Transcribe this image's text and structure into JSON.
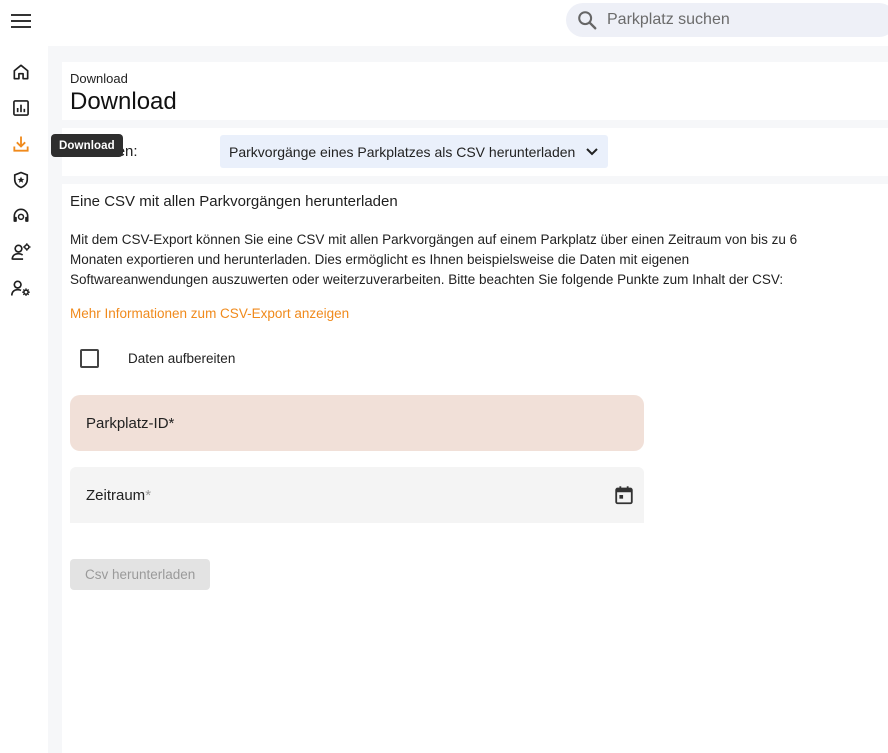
{
  "header": {
    "menu_icon": "hamburger-menu-icon",
    "search": {
      "placeholder": "Parkplatz suchen",
      "value": "",
      "icon": "search-icon"
    }
  },
  "sidebar": {
    "items": [
      {
        "name": "home",
        "icon": "home-icon",
        "active": false
      },
      {
        "name": "statistics",
        "icon": "bar-chart-icon",
        "active": false
      },
      {
        "name": "download",
        "icon": "download-icon",
        "active": true
      },
      {
        "name": "security",
        "icon": "shield-star-icon",
        "active": false
      },
      {
        "name": "support",
        "icon": "headset-support-icon",
        "active": false
      },
      {
        "name": "user-management",
        "icon": "user-settings-icon",
        "active": false
      },
      {
        "name": "account-settings",
        "icon": "user-gear-icon",
        "active": false
      }
    ],
    "active_color": "#f08a1c"
  },
  "tooltip": {
    "text": "Download"
  },
  "page": {
    "breadcrumb": "Download",
    "title": "Download"
  },
  "selector": {
    "label": "uswählen:",
    "selected_value": "Parkvorgänge eines Parkplatzes als CSV herunterladen"
  },
  "main": {
    "section_title": "Eine CSV mit allen Parkvorgängen herunterladen",
    "description": "Mit dem CSV-Export können Sie eine CSV mit allen Parkvorgängen auf einem Parkplatz über einen Zeitraum von bis zu 6 Monaten exportieren und herunterladen. Dies ermöglicht es Ihnen beispielsweise die Daten mit eigenen Softwareanwendungen auszuwerten oder weiterzuverarbeiten. Bitte beachten Sie folgende Punkte zum Inhalt der CSV:",
    "more_info_link": "Mehr Informationen zum CSV-Export anzeigen",
    "checkbox": {
      "label": "Daten aufbereiten",
      "checked": false
    },
    "fields": {
      "parkplatz_id": {
        "label": "Parkplatz-ID",
        "required_mark": "*",
        "value": ""
      },
      "zeitraum": {
        "label": "Zeitraum",
        "required_mark": "*",
        "value": "",
        "icon": "calendar-icon"
      }
    },
    "submit_button": {
      "label": "Csv herunterladen",
      "disabled": true
    }
  },
  "colors": {
    "accent": "#f08a1c",
    "error_field_bg": "#f1e0d8",
    "select_bg": "#eaf0fb",
    "search_bg": "#eef0f7"
  }
}
